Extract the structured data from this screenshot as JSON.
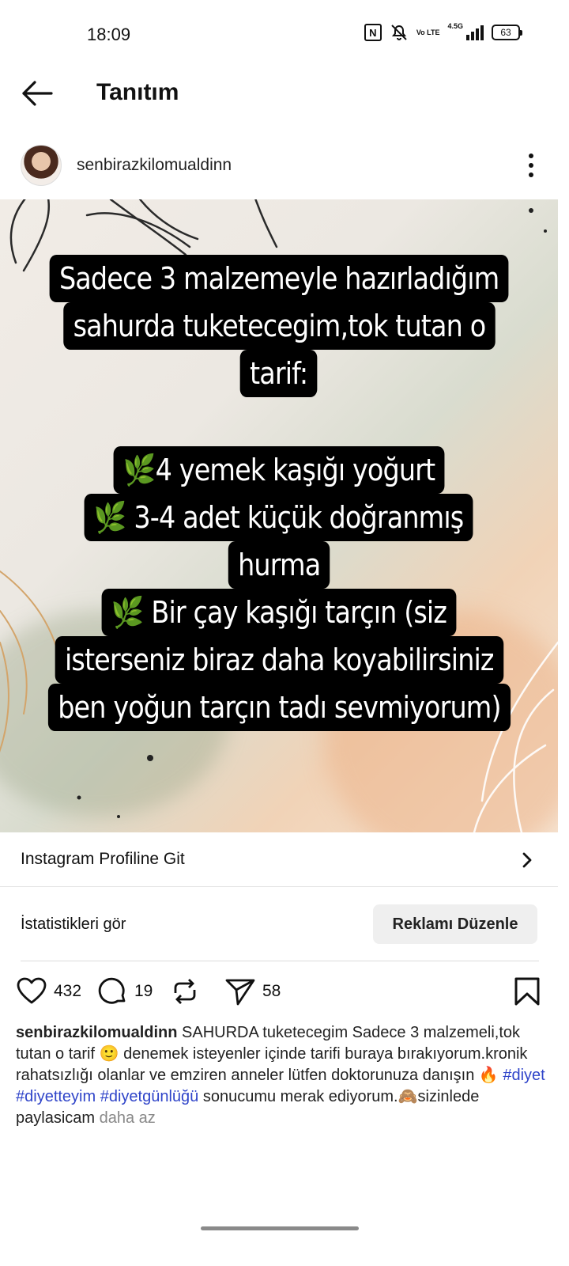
{
  "status_bar": {
    "time": "18:09",
    "battery": "63",
    "network": "4.5G",
    "volte": "Vo LTE"
  },
  "app_bar": {
    "title": "Tanıtım"
  },
  "post": {
    "username": "senbirazkilomualdinn",
    "image_text": {
      "intro_lines": [
        "Sadece 3 malzemeyle hazırladığım",
        "sahurda tuketecegim,tok tutan o",
        "tarif:"
      ],
      "ingredient_lines": [
        "🌿4 yemek kaşığı yoğurt",
        "🌿 3-4 adet küçük doğranmış",
        "hurma",
        "🌿 Bir çay kaşığı tarçın (siz",
        "isterseniz biraz daha koyabilirsiniz",
        "ben yoğun tarçın tadı sevmiyorum)"
      ]
    }
  },
  "profile_link": {
    "label": "Instagram Profiline Git"
  },
  "stats": {
    "label": "İstatistikleri gör",
    "edit_button": "Reklamı Düzenle"
  },
  "actions": {
    "likes": "432",
    "comments": "19",
    "shares": "58"
  },
  "caption": {
    "username": "senbirazkilomualdinn",
    "text_1": " SAHURDA tuketecegim Sadece 3 malzemeli,tok tutan o tarif 🙂 denemek isteyenler içinde tarifi buraya bırakıyorum.kronik rahatsızlığı olanlar ve emziren anneler lütfen doktorunuza danışın 🔥 ",
    "hashtags": [
      "#diyet",
      "#diyetteyim",
      "#diyetgünlüğü"
    ],
    "text_2": " sonucumu merak ediyorum.🙈sizinlede paylasicam ",
    "less": "daha az"
  },
  "colors": {
    "hashtag": "#2f44c9",
    "text_bg": "#000000"
  }
}
